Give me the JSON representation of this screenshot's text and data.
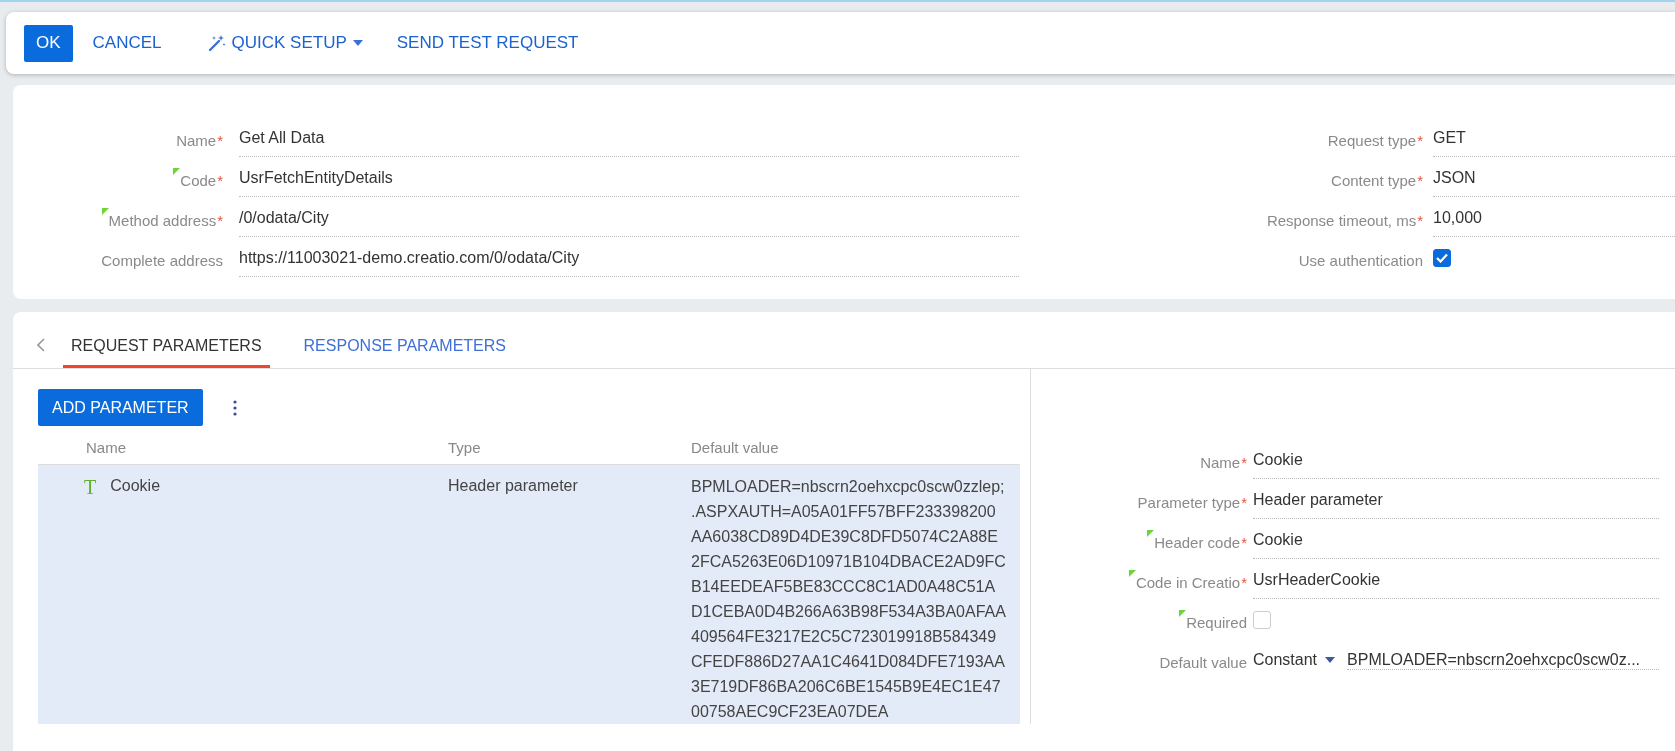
{
  "toolbar": {
    "buttons": [
      {
        "label": "OK",
        "kind": "primary"
      },
      {
        "label": "CANCEL",
        "kind": "link"
      },
      {
        "label": "QUICK SETUP",
        "kind": "menu"
      },
      {
        "label": "SEND TEST REQUEST",
        "kind": "link"
      }
    ]
  },
  "form": {
    "left": [
      {
        "label": "Name",
        "required_mark": "*",
        "flagged": false,
        "kind": "text",
        "value": "Get All Data"
      },
      {
        "label": "Code",
        "required_mark": "*",
        "flagged": true,
        "kind": "text",
        "value": "UsrFetchEntityDetails"
      },
      {
        "label": "Method address",
        "required_mark": "*",
        "flagged": true,
        "kind": "text",
        "value": "/0/odata/City"
      },
      {
        "label": "Complete address",
        "flagged": false,
        "kind": "text",
        "value": "https://11003021-demo.creatio.com/0/odata/City"
      }
    ],
    "right": [
      {
        "label": "Request type",
        "required_mark": "*",
        "flagged": false,
        "kind": "text",
        "value": "GET"
      },
      {
        "label": "Content type",
        "required_mark": "*",
        "flagged": false,
        "kind": "text",
        "value": "JSON"
      },
      {
        "label": "Response timeout, ms",
        "required_mark": "*",
        "flagged": false,
        "kind": "text",
        "value": "10,000"
      },
      {
        "label": "Use authentication",
        "flagged": false,
        "kind": "checkbox",
        "checked": true
      }
    ]
  },
  "tabs": [
    {
      "label": "REQUEST PARAMETERS",
      "selected": true
    },
    {
      "label": "RESPONSE PARAMETERS",
      "selected": false
    }
  ],
  "add_button": "ADD PARAMETER",
  "table": {
    "columns": [
      "Name",
      "Type",
      "Default value"
    ],
    "rows": [
      {
        "name": "Cookie",
        "type_icon": "T",
        "type": "Header parameter",
        "default_value": "BPMLOADER=nbscrn2oehxcpc0scw0zzlep; .ASPXAUTH=A05A01FF57BFF233398200AA6038CD89D4DE39C8DFD5074C2A88E2FCA5263E06D10971B104DBACE2AD9FCB14EEDEAF5BE83CCC8C1AD0A48C51AD1CEBA0D4B266A63B98F534A3BA0AFAA409564FE3217E2C5C723019918B584349CFEDF886D27AA1C4641D084DFE7193AA3E719DF86BA206C6BE1545B9E4EC1E4700758AEC9CF23EA07DEA",
        "selected": true
      }
    ]
  },
  "details": [
    {
      "label": "Name",
      "required_mark": "*",
      "flagged": false,
      "kind": "text",
      "value": "Cookie"
    },
    {
      "label": "Parameter type",
      "required_mark": "*",
      "flagged": false,
      "kind": "text",
      "value": "Header parameter"
    },
    {
      "label": "Header code",
      "required_mark": "*",
      "flagged": true,
      "kind": "text",
      "value": "Cookie"
    },
    {
      "label": "Code in Creatio",
      "required_mark": "*",
      "flagged": true,
      "kind": "text",
      "value": "UsrHeaderCookie"
    },
    {
      "label": "Required",
      "flagged": true,
      "kind": "checkbox",
      "checked": false
    },
    {
      "label": "Default value",
      "flagged": false,
      "kind": "source",
      "source": "Constant",
      "value": "BPMLOADER=nbscrn2oehxcpc0scw0z..."
    }
  ]
}
